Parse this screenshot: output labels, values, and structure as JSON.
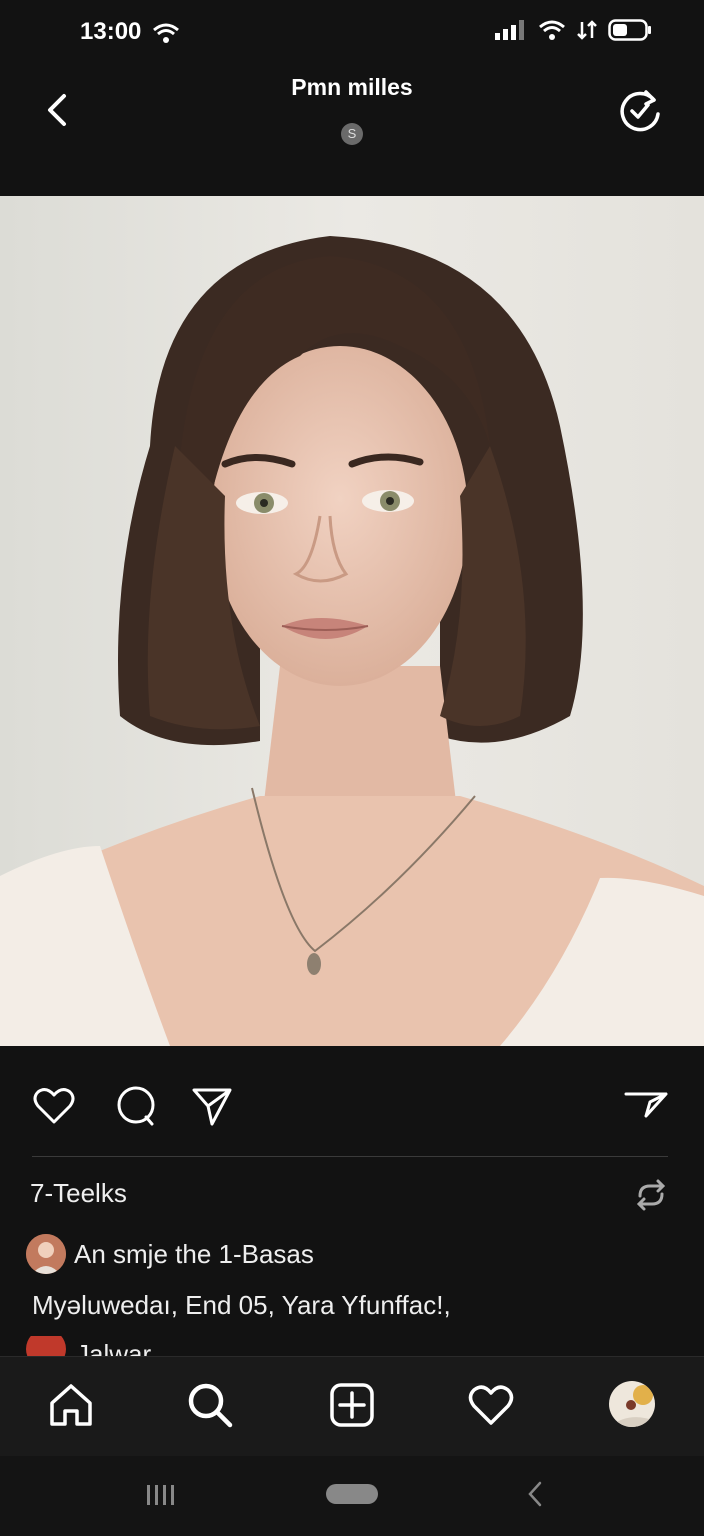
{
  "status_bar": {
    "time": "13:00"
  },
  "header": {
    "title": "Pmn milles",
    "badge": "S"
  },
  "post": {
    "likes": "7-Teelks",
    "caption": "An smje the 1-Basas",
    "comment": "Myәluwedaı, End 05, Yara Yfunffac!,",
    "partial_comment": "Jalwar"
  },
  "icons": {
    "back": "chevron-left-icon",
    "sync": "refresh-check-icon",
    "like": "heart-icon",
    "comment": "comment-icon",
    "share": "send-icon",
    "save": "send-alt-icon",
    "repeat": "repeat-icon",
    "nav": [
      "home-icon",
      "search-icon",
      "add-icon",
      "heart-icon",
      "profile-avatar"
    ]
  },
  "colors": {
    "background": "#121212",
    "nav_background": "#1a1a1a",
    "divider": "#3a3a3a"
  }
}
